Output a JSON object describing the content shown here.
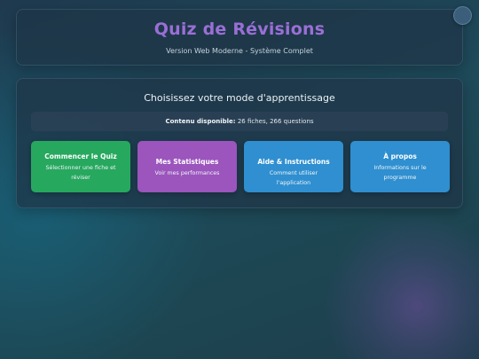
{
  "header": {
    "title": "Quiz de Révisions",
    "subtitle": "Version Web Moderne - Système Complet"
  },
  "main": {
    "heading": "Choisissez votre mode d'apprentissage",
    "content_label": "Contenu disponible:",
    "content_value": "26 fiches, 266 questions",
    "buttons": [
      {
        "label": "Commencer le Quiz",
        "desc": "Sélectionner une fiche et réviser"
      },
      {
        "label": "Mes Statistiques",
        "desc": "Voir mes performances"
      },
      {
        "label": "Aide & Instructions",
        "desc": "Comment utiliser l'application"
      },
      {
        "label": "À propos",
        "desc": "Informations sur le programme"
      }
    ]
  },
  "colors": {
    "title": "#9b6fd6",
    "quiz_button": "#27a85f",
    "stats_button": "#9b55bd",
    "help_button": "#2f8fd0",
    "about_button": "#2f8fd0"
  }
}
